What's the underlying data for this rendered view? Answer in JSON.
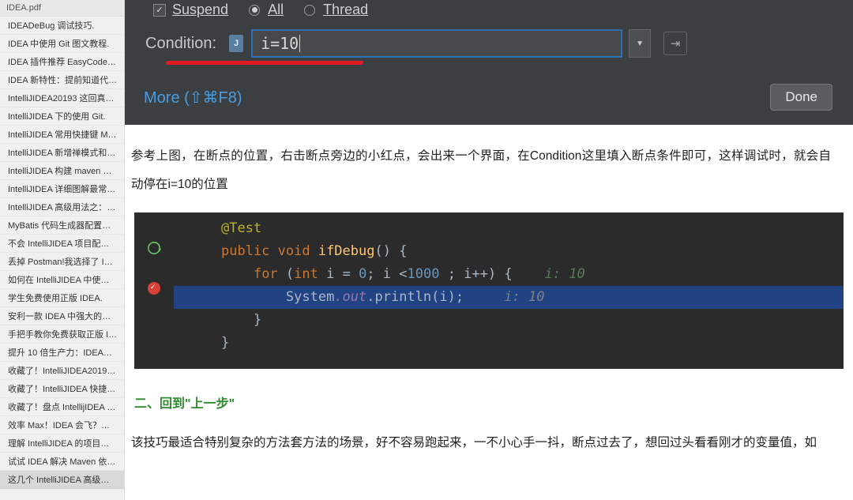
{
  "sidebar": {
    "header": "IDEA.pdf",
    "items": [
      "IDEADeBug 调试技巧.",
      "IDEA 中使用 Git 图文教程.",
      "IDEA 插件推荐 EasyCode 一…",
      "IDEA 新特性：提前知道代…",
      "IntelliJIDEA20193 这回真…",
      "IntelliJIDEA 下的使用 Git.",
      "IntelliJIDEA 常用快捷键 Ma…",
      "IntelliJIDEA 新增禅模式和 Li…",
      "IntelliJIDEA 构建 maven 多…",
      "IntelliJIDEA 详细图解最常…",
      "IntelliJIDEA 高级用法之：集…",
      "MyBatis 代码生成器配置详…",
      "不会 IntelliJIDEA 项目配置…",
      "丢掉 Postman!我选择了 IDE…",
      "如何在 IntelliJIDEA 中使用 Git.",
      "学生免费使用正版 IDEA.",
      "安利一款 IDEA 中强大的代…",
      "手把手教你免费获取正版 Int…",
      "提升 10 倍生产力：IDEA远…",
      "收藏了！IntelliJIDEA2019 …",
      "收藏了！IntelliJIDEA 快捷…",
      "收藏了！盘点 IntellijIDEA 那…",
      "效率 Max！IDEA 会飞？只…",
      "理解 IntelliJIDEA 的项目配…",
      "试试 IDEA 解决 Maven 依赖…",
      "这几个 IntelliJIDEA 高级调…"
    ],
    "activeIndex": 25
  },
  "panel": {
    "suspend": "Suspend",
    "all": "All",
    "thread": "Thread",
    "conditionLabel": "Condition:",
    "conditionValue": "i=10",
    "more": "More (⇧⌘F8)",
    "done": "Done"
  },
  "paragraph1": "参考上图，在断点的位置，右击断点旁边的小红点，会出来一个界面，在Condition这里填入断点条件即可，这样调试时，就会自动停在i=10的位置",
  "code": {
    "l1_ann": "@Test",
    "l2_pre": "public void ",
    "l2_fn": "ifDebug",
    "l2_post": "() {",
    "l3_pre": "for ",
    "l3_par": "(",
    "l3_int": "int",
    "l3_mid": " i = ",
    "l3_zero": "0",
    "l3_semi": "; i <",
    "l3_thou": "1000",
    "l3_end": " ; i++) {",
    "l3_cm": "  i: 10",
    "l4_sys": "System",
    "l4_out": ".out",
    "l4_pr": ".println(i);",
    "l4_cm": "  i: 10",
    "l5": "}",
    "l6": "}"
  },
  "heading": "二、回到\"上一步\"",
  "paragraph2": "该技巧最适合特别复杂的方法套方法的场景，好不容易跑起来，一不小心手一抖，断点过去了，想回过头看看刚才的变量值，如"
}
